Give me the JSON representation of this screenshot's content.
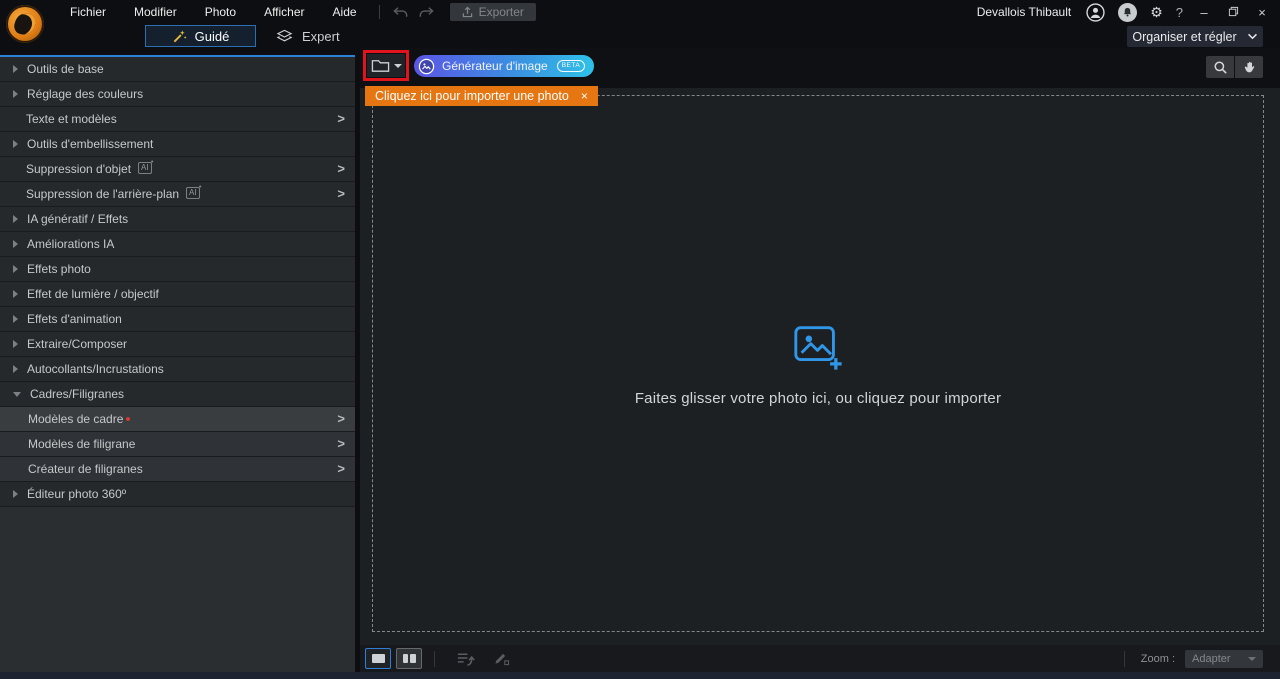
{
  "titlebar": {
    "menus": [
      "Fichier",
      "Modifier",
      "Photo",
      "Afficher",
      "Aide"
    ],
    "export_label": "Exporter",
    "user_name": "Devallois Thibault"
  },
  "modebar": {
    "guided_label": "Guidé",
    "expert_label": "Expert",
    "organize_label": "Organiser et régler"
  },
  "sidebar": {
    "ai_badge": "AI",
    "items": [
      {
        "label": "Outils de base",
        "state": "collapsible"
      },
      {
        "label": "Réglage des couleurs",
        "state": "collapsible"
      },
      {
        "label": "Texte et modèles",
        "state": "drill-in"
      },
      {
        "label": "Outils d'embellissement",
        "state": "collapsible"
      },
      {
        "label": "Suppression d'objet",
        "state": "drill-in",
        "ai": true
      },
      {
        "label": "Suppression de l'arrière-plan",
        "state": "drill-in",
        "ai": true
      },
      {
        "label": "IA génératif / Effets",
        "state": "collapsible"
      },
      {
        "label": "Améliorations IA",
        "state": "collapsible"
      },
      {
        "label": "Effets photo",
        "state": "collapsible"
      },
      {
        "label": "Effet de lumière / objectif",
        "state": "collapsible"
      },
      {
        "label": "Effets d'animation",
        "state": "collapsible"
      },
      {
        "label": "Extraire/Composer",
        "state": "collapsible"
      },
      {
        "label": "Autocollants/Incrustations",
        "state": "collapsible"
      },
      {
        "label": "Cadres/Filigranes",
        "state": "expanded"
      },
      {
        "label": "Modèles de cadre",
        "state": "drill-in",
        "sub": true,
        "new_indicator": true
      },
      {
        "label": "Modèles de filigrane",
        "state": "drill-in",
        "sub": true
      },
      {
        "label": "Créateur de filigranes",
        "state": "drill-in",
        "sub": true
      },
      {
        "label": "Éditeur photo 360º",
        "state": "collapsible"
      }
    ]
  },
  "toolbar": {
    "generator_label": "Générateur d'image",
    "beta_badge": "BETA"
  },
  "import_tooltip": {
    "text": "Cliquez ici pour importer une photo",
    "close": "×"
  },
  "dropzone": {
    "message": "Faites glisser votre photo ici, ou cliquez pour importer"
  },
  "statusbar": {
    "zoom_label": "Zoom :",
    "zoom_value": "Adapter"
  },
  "icons": {
    "gear": "⚙",
    "help": "?",
    "minimize": "–",
    "close": "×",
    "sidebar_chevron": ">"
  },
  "colors": {
    "accent_blue": "#2e81d8",
    "tooltip_orange": "#e57612",
    "highlight_red": "#e0141c",
    "generator_gradient_start": "#5b55e6",
    "generator_gradient_end": "#2fc1e8",
    "drop_icon_blue": "#3096e8"
  }
}
